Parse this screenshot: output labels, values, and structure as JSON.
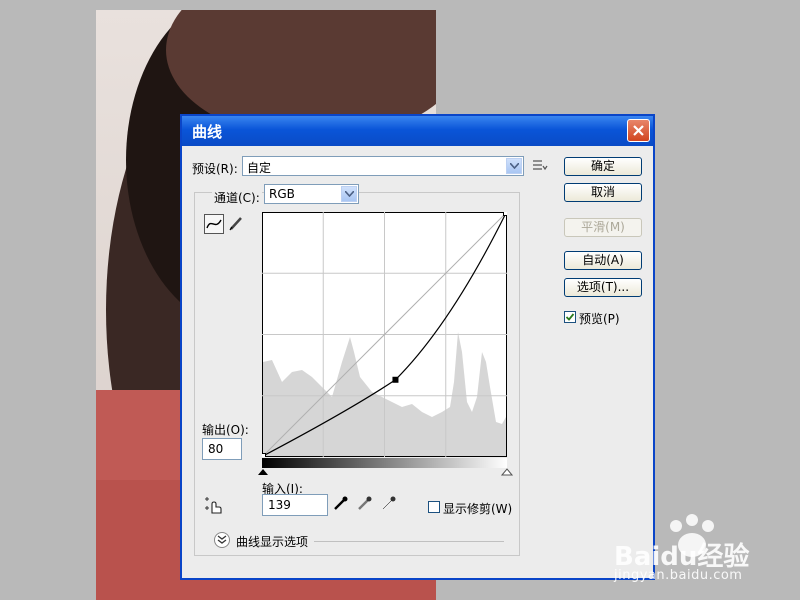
{
  "colors": {
    "title_bar": "#0a55d8",
    "dialog_bg": "#ececec",
    "preview_check": "#2a7a1c"
  },
  "dialog": {
    "title": "曲线",
    "preset_label": "预设(R):",
    "preset_value": "自定",
    "preset_menu_icon": "preset-options-icon",
    "channel_label": "通道(C):",
    "channel_value": "RGB",
    "output_label": "输出(O):",
    "output_value": "80",
    "input_label": "输入(I):",
    "input_value": "139",
    "show_clipping_label": "显示修剪(W)",
    "curve_display_options_label": "曲线显示选项"
  },
  "buttons": {
    "ok": "确定",
    "cancel": "取消",
    "smooth": "平滑(M)",
    "auto": "自动(A)",
    "options": "选项(T)...",
    "preview": "预览(P)",
    "preview_checked": true
  },
  "curve": {
    "points": [
      [
        0,
        0
      ],
      [
        139,
        80
      ],
      [
        255,
        255
      ]
    ]
  },
  "watermark": {
    "brand": "Baidu经验",
    "url": "jingyan.baidu.com"
  }
}
